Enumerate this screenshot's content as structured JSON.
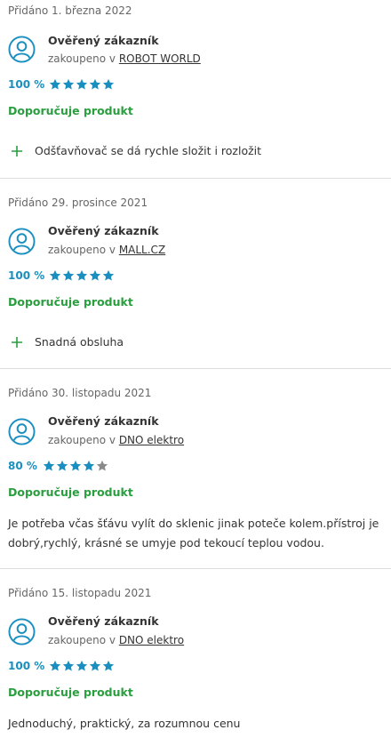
{
  "reviews": [
    {
      "date": "Přidáno 1. března 2022",
      "author": "Ověřený zákazník",
      "bought_prefix": "zakoupeno v ",
      "shop": "ROBOT WORLD",
      "percent_label": "100 %",
      "rating_fraction": 1.0,
      "recommend": "Doporučuje produkt",
      "pro": "Odšťavňovač se dá rychle složit i rozložit"
    },
    {
      "date": "Přidáno 29. prosince 2021",
      "author": "Ověřený zákazník",
      "bought_prefix": "zakoupeno v ",
      "shop": "MALL.CZ",
      "percent_label": "100 %",
      "rating_fraction": 1.0,
      "recommend": "Doporučuje produkt",
      "pro": "Snadná obsluha"
    },
    {
      "date": "Přidáno 30. listopadu 2021",
      "author": "Ověřený zákazník",
      "bought_prefix": "zakoupeno v ",
      "shop": "DNO elektro",
      "percent_label": "80 %",
      "rating_fraction": 0.8,
      "recommend": "Doporučuje produkt",
      "text": "Je potřeba včas šťávu vylít do sklenic jinak poteče kolem.přístroj je dobrý,rychlý, krásné se umyje pod tekoucí teplou vodou."
    },
    {
      "date": "Přidáno 15. listopadu 2021",
      "author": "Ověřený zákazník",
      "bought_prefix": "zakoupeno v ",
      "shop": "DNO elektro",
      "percent_label": "100 %",
      "rating_fraction": 1.0,
      "recommend": "Doporučuje produkt",
      "text": "Jednoduchý, praktický, za rozumnou cenu"
    }
  ],
  "colors": {
    "star_filled": "#1a8fbf",
    "star_empty": "#8a8a8a",
    "recommend": "#2a9e3f",
    "percent": "#1a8fbf",
    "avatar": "#1a8fbf",
    "plus": "#2a9e3f"
  },
  "icons": {
    "avatar": "user-avatar-icon",
    "star": "star-icon",
    "pro": "plus-icon"
  }
}
